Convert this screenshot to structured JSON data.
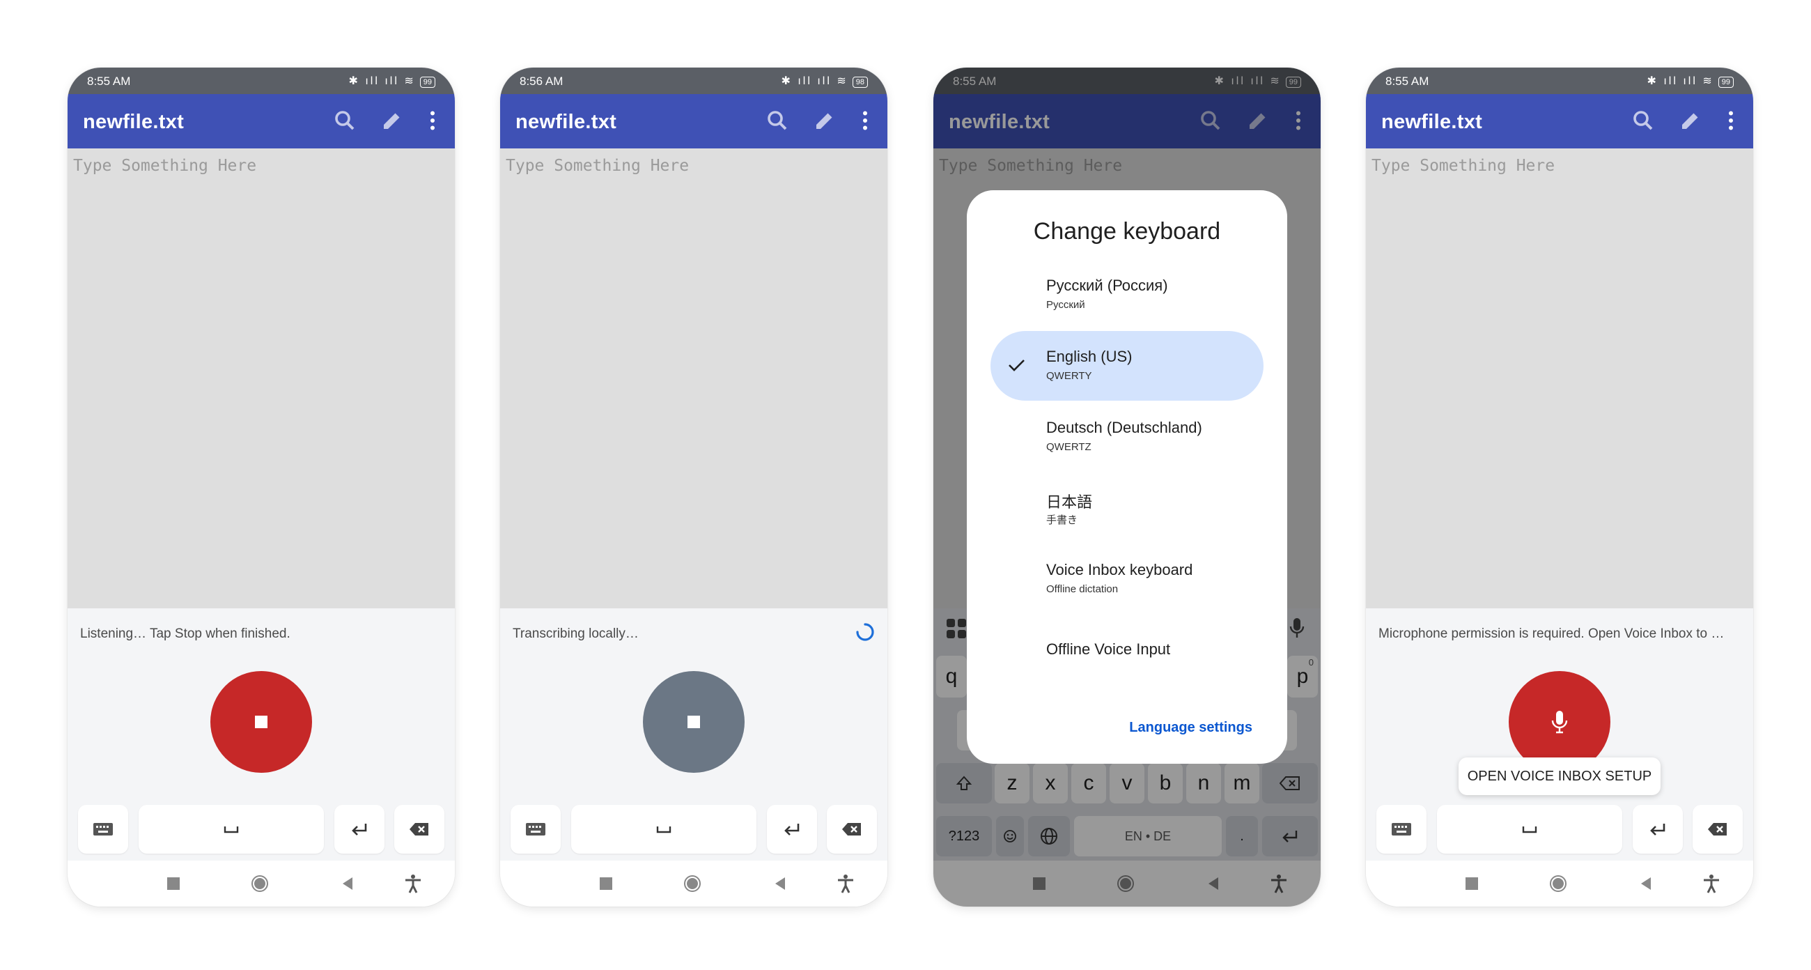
{
  "common": {
    "app_title": "newfile.txt",
    "placeholder": "Type Something Here",
    "icons": [
      "search-icon",
      "edit-icon",
      "overflow-menu-icon",
      "keyboard-icon",
      "space-icon",
      "enter-icon",
      "backspace-icon",
      "recents-icon",
      "home-icon",
      "back-icon",
      "accessibility-icon"
    ]
  },
  "screens": [
    {
      "time": "8:55 AM",
      "battery": "99",
      "status": "Listening… Tap Stop when finished.",
      "button_state": "recording",
      "button_color": "#c62828"
    },
    {
      "time": "8:56 AM",
      "battery": "98",
      "status": "Transcribing locally…",
      "button_state": "transcribing",
      "button_color": "#6b7785"
    },
    {
      "time": "8:55 AM",
      "battery": "99",
      "dialog": {
        "title": "Change keyboard",
        "options": [
          {
            "name": "Русский (Россия)",
            "sub": "Русский",
            "selected": false
          },
          {
            "name": "English (US)",
            "sub": "QWERTY",
            "selected": true
          },
          {
            "name": "Deutsch (Deutschland)",
            "sub": "QWERTZ",
            "selected": false
          },
          {
            "name": "日本語",
            "sub": "手書き",
            "selected": false
          },
          {
            "name": "Voice Inbox keyboard",
            "sub": "Offline dictation",
            "selected": false
          },
          {
            "name": "Offline Voice Input",
            "sub": "",
            "selected": false
          }
        ],
        "language_settings": "Language settings"
      },
      "keyboard": {
        "row1_left": "q",
        "row1_right": "p",
        "row1_right_hint": "0",
        "row3": [
          "z",
          "x",
          "c",
          "v",
          "b",
          "n",
          "m"
        ],
        "symbols_key": "?123",
        "space_label": "EN • DE",
        "period": "."
      }
    },
    {
      "time": "8:55 AM",
      "battery": "99",
      "status": "Microphone permission is required. Open Voice Inbox to …",
      "button_state": "mic",
      "button_color": "#c62828",
      "tooltip": "OPEN VOICE INBOX SETUP"
    }
  ]
}
